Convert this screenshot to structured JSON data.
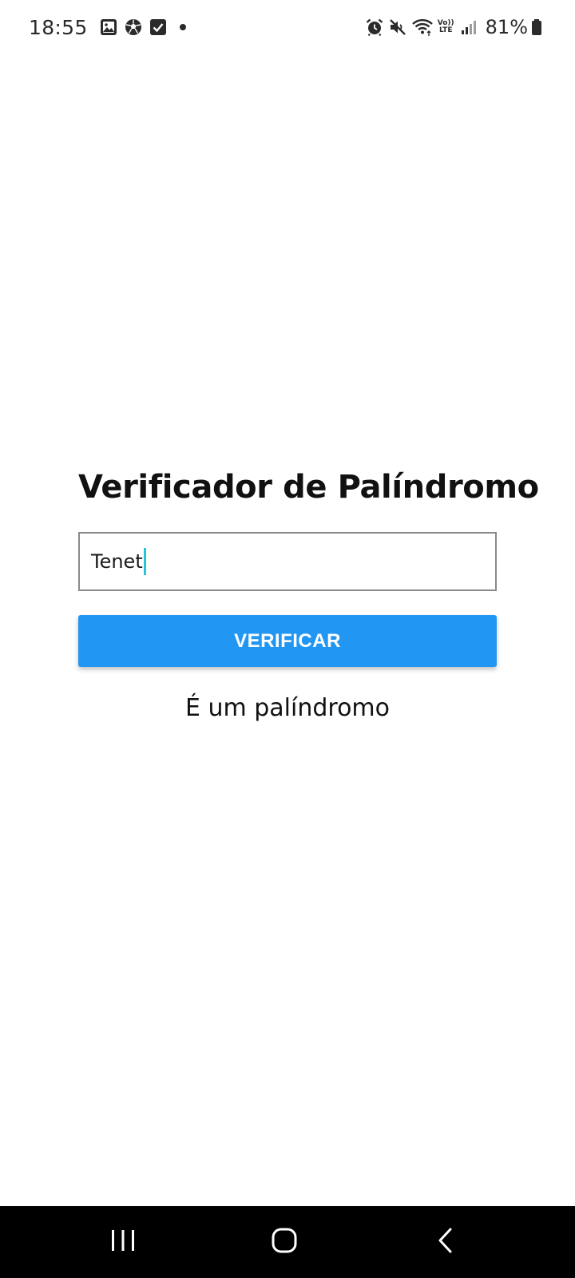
{
  "status_bar": {
    "time": "18:55",
    "notification_icons": [
      "gallery-icon",
      "soccer-ball-icon",
      "checkbox-icon",
      "dot-icon"
    ],
    "system_icons": [
      "alarm-icon",
      "mute-icon",
      "wifi-icon",
      "volte-icon",
      "signal-icon"
    ],
    "volte_label_top": "Vo))",
    "volte_label_bottom": "LTE",
    "battery_percent": "81%"
  },
  "main": {
    "title": "Verificador de Palíndromo",
    "input": {
      "value": "Tenet"
    },
    "verify_button_label": "VERIFICAR",
    "result": "É um palíndromo"
  },
  "nav_bar": {
    "buttons": [
      "recents-icon",
      "home-icon",
      "back-icon"
    ]
  },
  "colors": {
    "accent": "#2196f3",
    "caret": "#26c6da",
    "input_border": "#8a8a8a",
    "text": "#111111",
    "nav_background": "#000000"
  }
}
